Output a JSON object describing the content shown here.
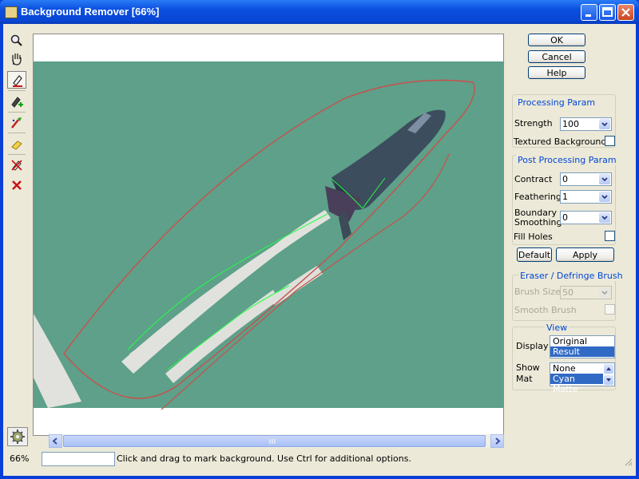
{
  "window": {
    "title": "Background Remover [66%]"
  },
  "toolbar": {
    "tools": [
      "zoom-tool",
      "hand-tool",
      "mark-background-brush",
      "mark-foreground-brush",
      "magic-brush",
      "eraser-tool",
      "clear-marks-tool",
      "delete-tool"
    ],
    "active_index": 2
  },
  "canvas": {
    "zoom_percent": 66,
    "background_color": "#5ea08a",
    "outline_color": "#c9504a",
    "stroke_color": "#22ff44"
  },
  "buttons": {
    "ok": "OK",
    "cancel": "Cancel",
    "help": "Help",
    "default": "Default",
    "apply": "Apply"
  },
  "processing": {
    "title": "Processing Param",
    "strength_label": "Strength",
    "strength_value": "100",
    "textured_label": "Textured Background",
    "textured_checked": false
  },
  "post": {
    "title": "Post Processing Param",
    "contract_label": "Contract",
    "contract_value": "0",
    "feathering_label": "Feathering",
    "feathering_value": "1",
    "boundary_label_1": "Boundary",
    "boundary_label_2": "Smoothing",
    "boundary_value": "0",
    "fill_holes_label": "Fill Holes",
    "fill_holes_checked": false
  },
  "eraser": {
    "title": "Eraser / Defringe  Brush",
    "brush_size_label": "Brush Size",
    "brush_size_value": "50",
    "smooth_label": "Smooth Brush",
    "smooth_checked": false
  },
  "view": {
    "title": "View",
    "display_label": "Display",
    "display_options": [
      "Original",
      "Result"
    ],
    "display_selected": "Result",
    "showmat_label_1": "Show",
    "showmat_label_2": "Mat",
    "showmat_options": [
      "None",
      "Cyan Matte"
    ],
    "showmat_selected": "Cyan Matte"
  },
  "status": {
    "zoom": "66%",
    "message": "Click and drag to mark background. Use Ctrl for additional options."
  }
}
